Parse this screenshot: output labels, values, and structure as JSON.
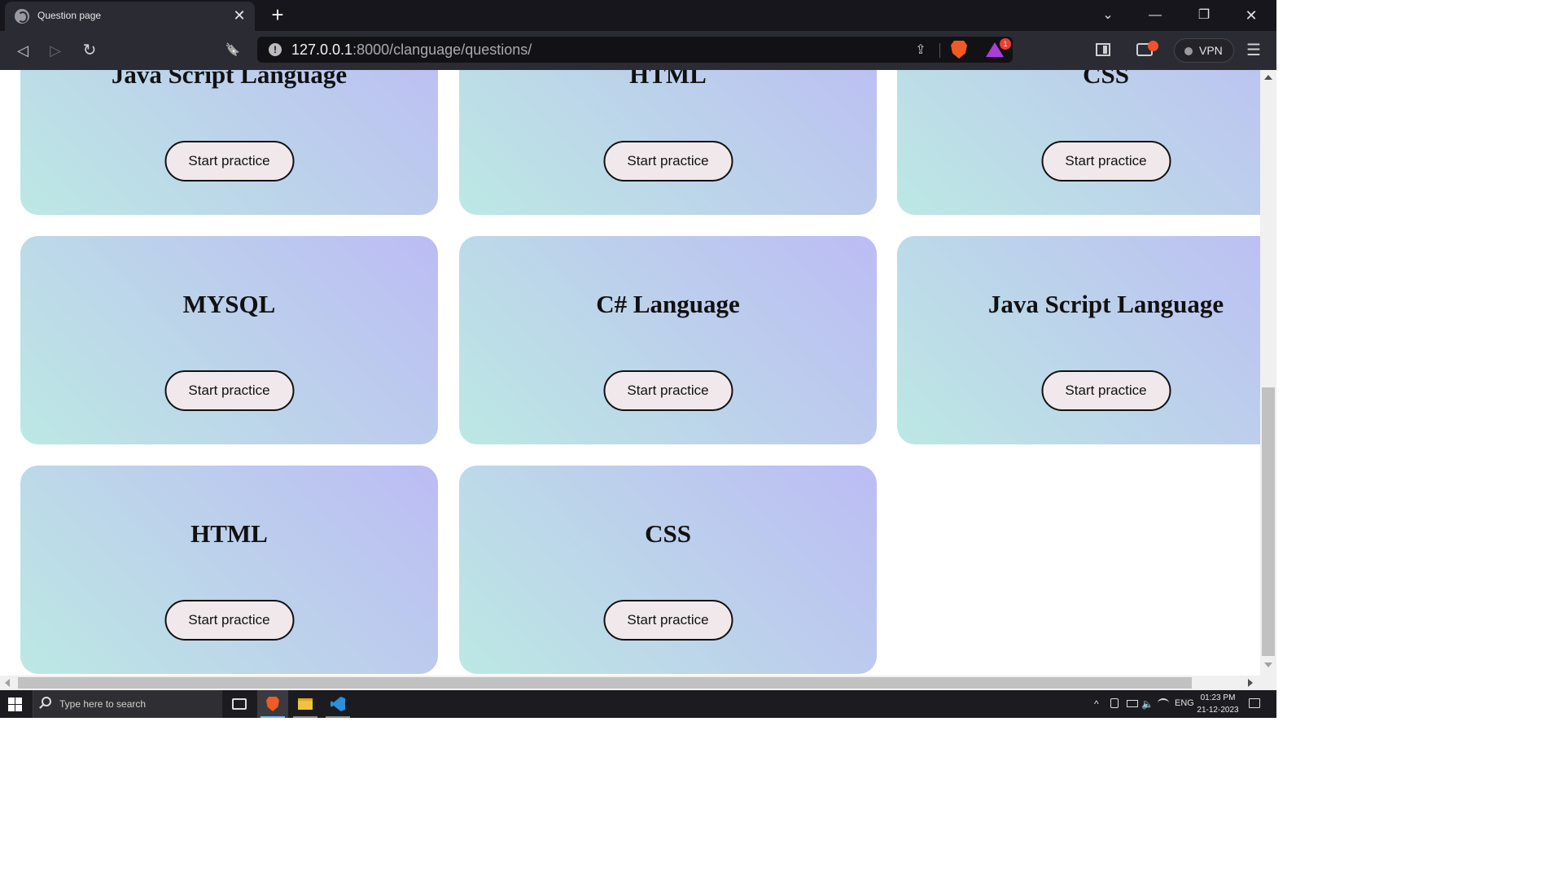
{
  "browser": {
    "tab": {
      "title": "Question page",
      "favicon": "globe-icon",
      "close_glyph": "✕"
    },
    "new_tab_glyph": "+",
    "window_controls": {
      "minimize": "—",
      "restore": "❐",
      "close": "✕",
      "tab_list": "⌄"
    },
    "nav": {
      "back": "◁",
      "forward": "▷",
      "reload": "↻",
      "bookmark": "🔖"
    },
    "address": {
      "host": "127.0.0.1",
      "rest": ":8000/clanguage/questions/",
      "info_glyph": "!"
    },
    "share_glyph": "⇪",
    "rewards_badge": "1",
    "vpn_label": "VPN",
    "menu_glyph": "☰"
  },
  "cards": [
    {
      "title": "Java Script Language",
      "button": "Start practice"
    },
    {
      "title": "HTML",
      "button": "Start practice"
    },
    {
      "title": "CSS",
      "button": "Start practice"
    },
    {
      "title": "MYSQL",
      "button": "Start practice"
    },
    {
      "title": "C# Language",
      "button": "Start practice"
    },
    {
      "title": "Java Script Language",
      "button": "Start practice"
    },
    {
      "title": "HTML",
      "button": "Start practice"
    },
    {
      "title": "CSS",
      "button": "Start practice"
    }
  ],
  "colors": {
    "card_gradient_start": "#bce8e4",
    "card_gradient_end": "#bcbcf4",
    "button_bg": "#f0e8ea",
    "browser_chrome": "#2b2c33"
  },
  "taskbar": {
    "search_placeholder": "Type here to search",
    "tray_chevron": "^",
    "language": "ENG",
    "time": "01:23 PM",
    "date": "21-12-2023"
  }
}
